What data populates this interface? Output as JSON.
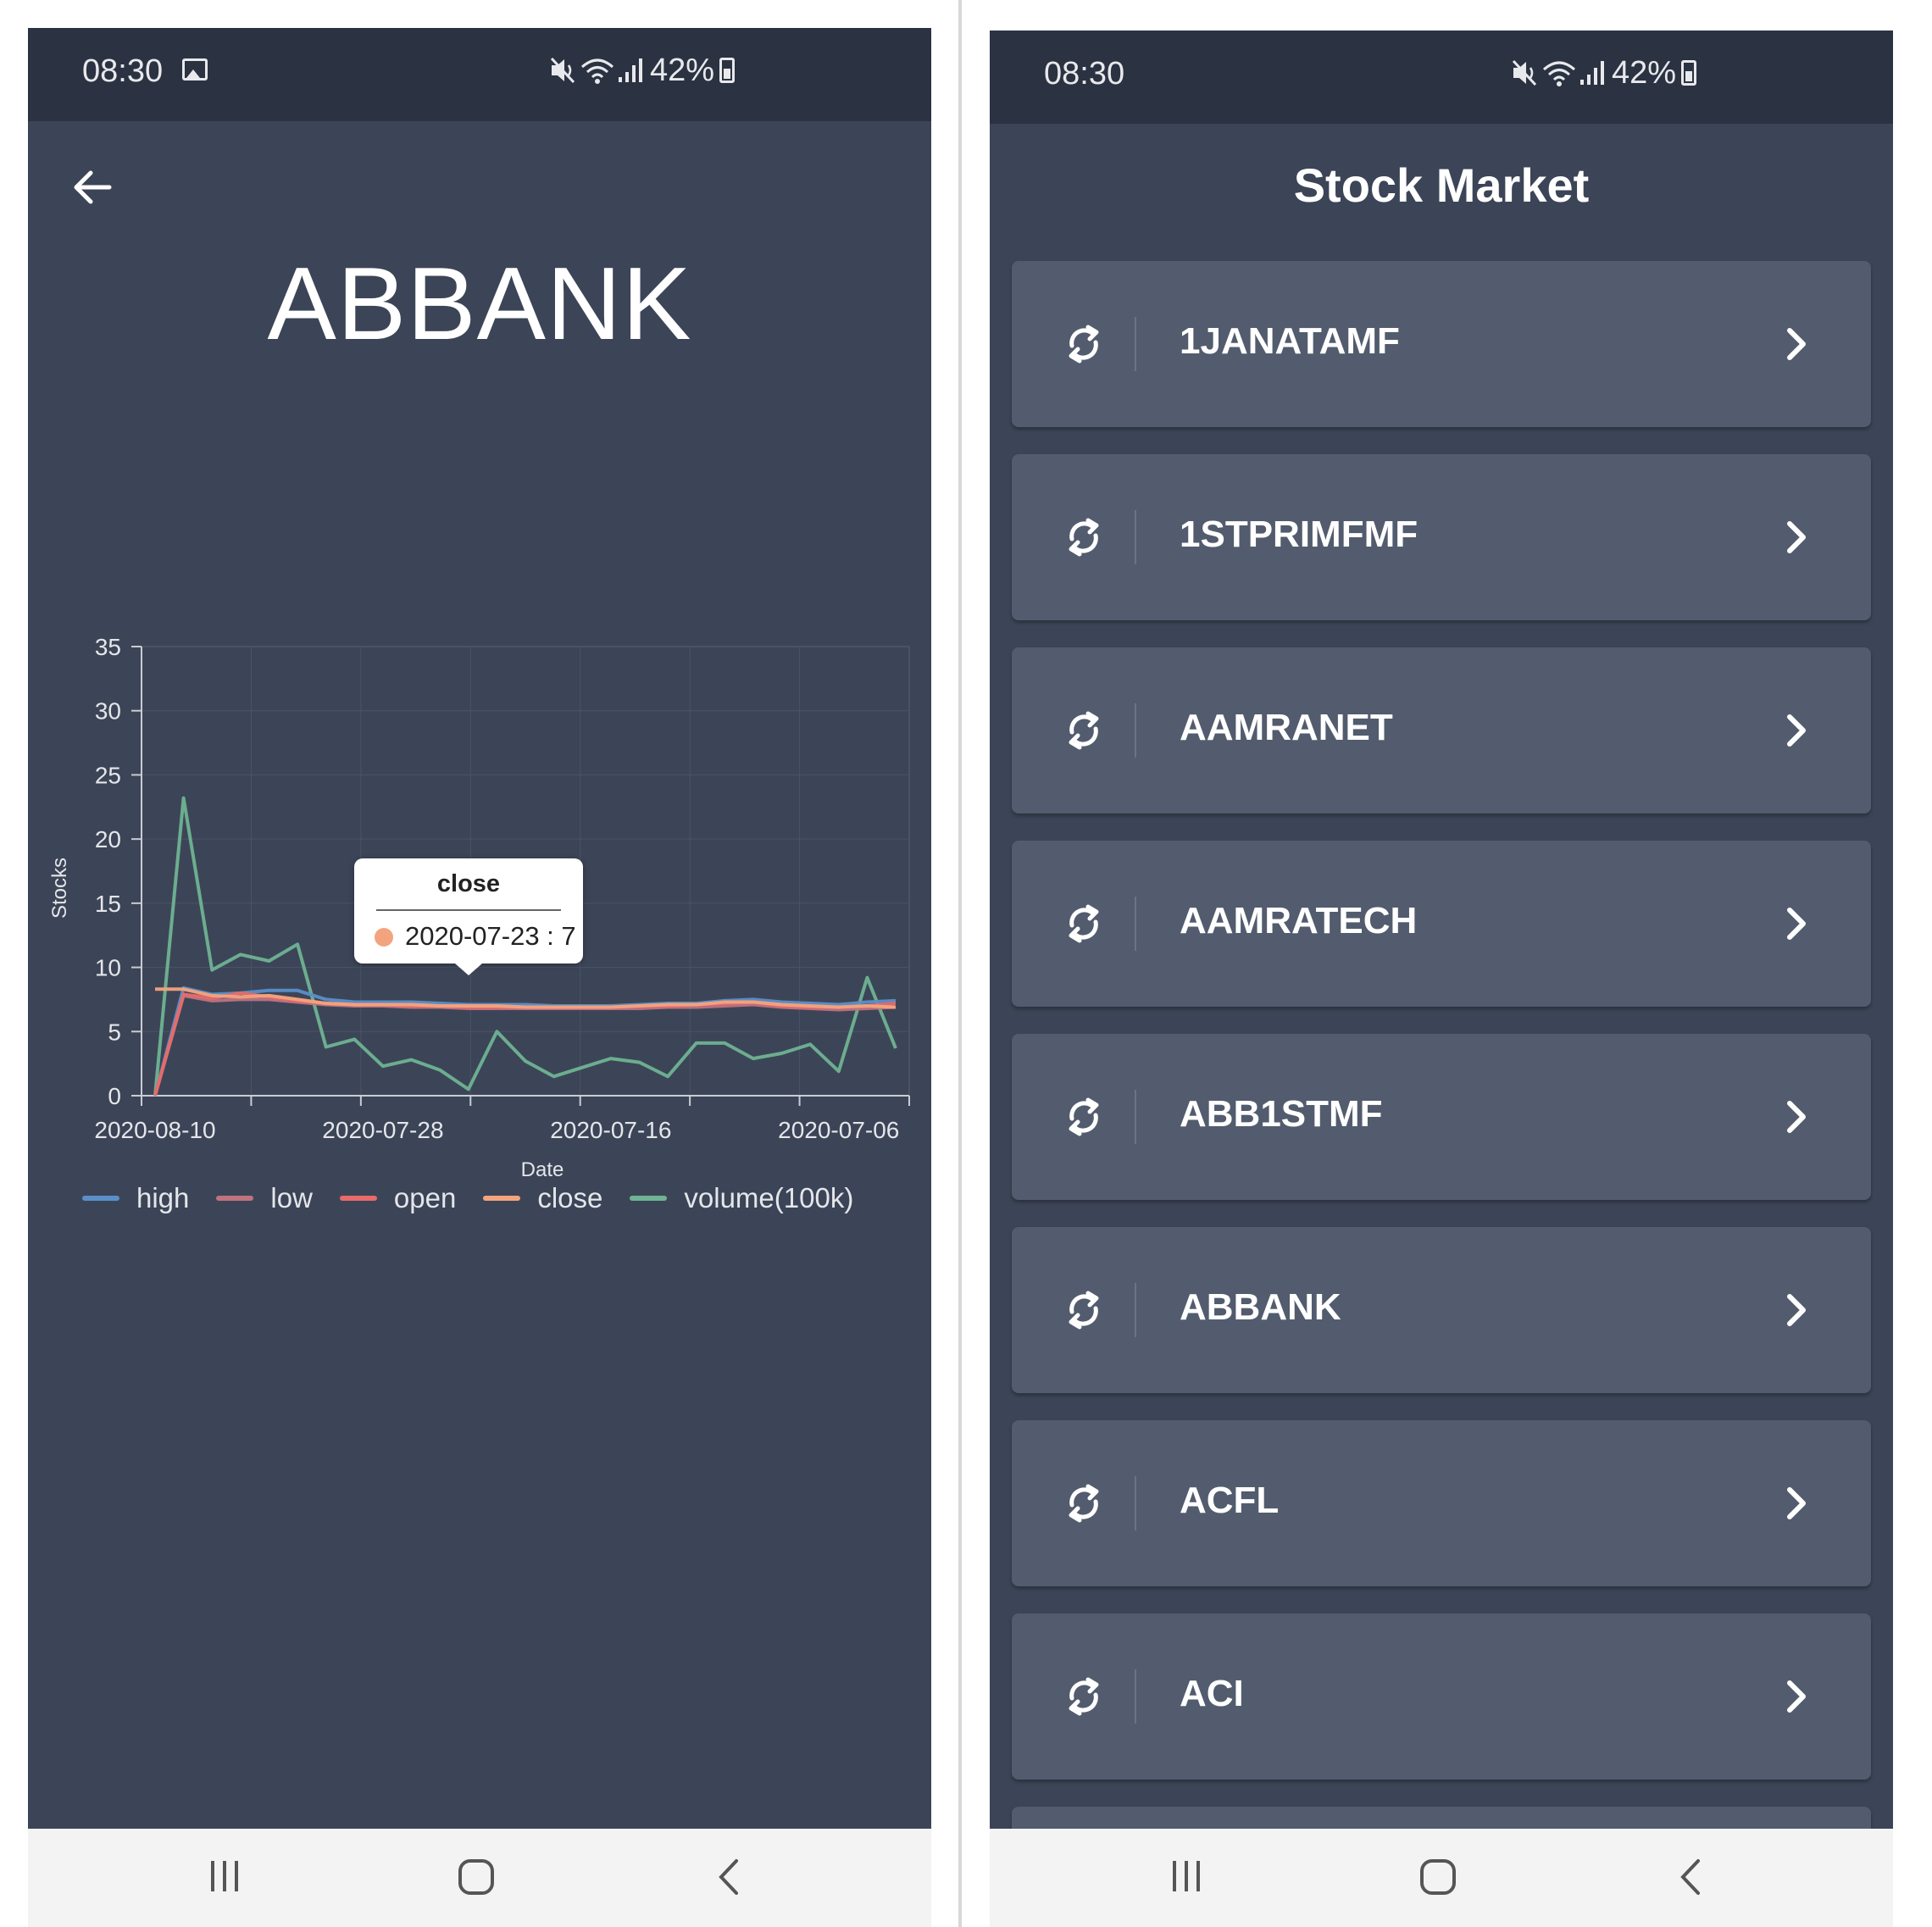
{
  "status_bar": {
    "time": "08:30",
    "battery": "42%"
  },
  "detail": {
    "title": "ABBANK",
    "chart_data": {
      "type": "line",
      "xlabel": "Date",
      "ylabel": "Stocks",
      "ylim": [
        0,
        35
      ],
      "yticks": [
        0,
        5,
        10,
        15,
        20,
        25,
        30,
        35
      ],
      "x_tick_labels": [
        "2020-08-10",
        "2020-07-28",
        "2020-07-16",
        "2020-07-06"
      ],
      "x_tick_label_positions": [
        0,
        8,
        16,
        24
      ],
      "grid": true,
      "legend": "bottom",
      "series": [
        {
          "name": "high",
          "color": "#5b8fc9",
          "values": [
            0,
            8.4,
            7.9,
            8.0,
            8.2,
            8.2,
            7.5,
            7.3,
            7.3,
            7.3,
            7.2,
            7.1,
            7.1,
            7.1,
            7.0,
            7.0,
            7.0,
            7.1,
            7.2,
            7.2,
            7.4,
            7.5,
            7.3,
            7.2,
            7.1,
            7.3,
            7.4
          ]
        },
        {
          "name": "low",
          "color": "#c0727f",
          "values": [
            0,
            7.8,
            7.4,
            7.5,
            7.5,
            7.3,
            7.1,
            7.0,
            7.0,
            6.9,
            6.9,
            6.8,
            6.8,
            6.8,
            6.8,
            6.8,
            6.8,
            6.8,
            6.9,
            6.9,
            7.0,
            7.1,
            6.9,
            6.8,
            6.7,
            6.8,
            6.9
          ]
        },
        {
          "name": "open",
          "color": "#e86a6a",
          "values": [
            0,
            7.9,
            7.6,
            8.0,
            7.7,
            7.4,
            7.2,
            7.1,
            7.1,
            7.0,
            7.0,
            6.9,
            6.9,
            6.9,
            6.9,
            6.9,
            6.9,
            7.0,
            7.0,
            7.1,
            7.2,
            7.3,
            7.0,
            6.9,
            6.9,
            7.0,
            7.2
          ]
        },
        {
          "name": "close",
          "color": "#f3a47e",
          "values": [
            8.3,
            8.3,
            7.8,
            7.7,
            7.8,
            7.5,
            7.2,
            7.1,
            7.1,
            7.1,
            7.0,
            7.0,
            7.0,
            6.9,
            6.9,
            6.9,
            6.9,
            7.0,
            7.1,
            7.1,
            7.3,
            7.3,
            7.1,
            7.0,
            6.9,
            7.0,
            6.9
          ]
        },
        {
          "name": "volume(100k)",
          "color": "#6fb394",
          "values": [
            0,
            23.2,
            9.8,
            11.0,
            10.5,
            11.8,
            3.8,
            4.4,
            2.3,
            2.8,
            2.0,
            0.5,
            5.0,
            2.7,
            1.5,
            2.2,
            2.9,
            2.6,
            1.5,
            4.1,
            4.1,
            2.9,
            3.3,
            4.0,
            1.9,
            9.2,
            3.7
          ]
        }
      ]
    },
    "tooltip": {
      "title": "close",
      "text": "2020-07-23 : 7",
      "dot_color": "#f3a47e"
    }
  },
  "list": {
    "title": "Stock Market",
    "items": [
      {
        "label": "1JANATAMF"
      },
      {
        "label": "1STPRIMFMF"
      },
      {
        "label": "AAMRANET"
      },
      {
        "label": "AAMRATECH"
      },
      {
        "label": "ABB1STMF"
      },
      {
        "label": "ABBANK"
      },
      {
        "label": "ACFL"
      },
      {
        "label": "ACI"
      }
    ]
  },
  "icons": {
    "back": "arrow-left-icon",
    "refresh": "refresh-icon",
    "chevron": "chevron-right-icon",
    "nav_recents": "recents-icon",
    "nav_home": "home-icon",
    "nav_back": "nav-back-icon"
  }
}
